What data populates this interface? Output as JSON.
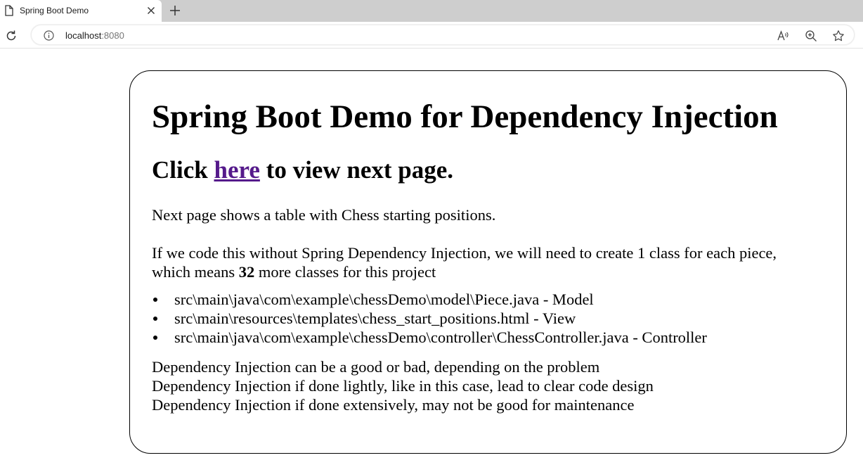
{
  "browser": {
    "tab_title": "Spring Boot Demo",
    "url_host": "localhost",
    "url_port": ":8080",
    "icons": {
      "page": "page-icon",
      "close": "close-icon",
      "new_tab": "plus-icon",
      "reload": "reload-icon",
      "info": "info-icon",
      "read_aloud": "read-aloud-icon",
      "zoom": "zoom-icon",
      "favorite": "star-icon"
    }
  },
  "content": {
    "title": "Spring Boot Demo for Dependency Injection",
    "click_prefix": "Click ",
    "click_link": "here",
    "click_suffix": " to view next page.",
    "intro": "Next page shows a table with Chess starting positions.",
    "without_di_line1": "If we code this without Spring Dependency Injection, we will need to create 1 class for each piece,",
    "without_di_line2_prefix": "which means ",
    "without_di_count": "32",
    "without_di_line2_suffix": " more classes for this project",
    "files": [
      "src\\main\\java\\com\\example\\chessDemo\\model\\Piece.java - Model",
      "src\\main\\resources\\templates\\chess_start_positions.html - View",
      "src\\main\\java\\com\\example\\chessDemo\\controller\\ChessController.java - Controller"
    ],
    "notes": [
      "Dependency Injection can be a good or bad, depending on the problem",
      "Dependency Injection if done lightly, like in this case, lead to clear code design",
      "Dependency Injection if done extensively, may not be good for maintenance"
    ],
    "link_color": "#551a8b"
  }
}
